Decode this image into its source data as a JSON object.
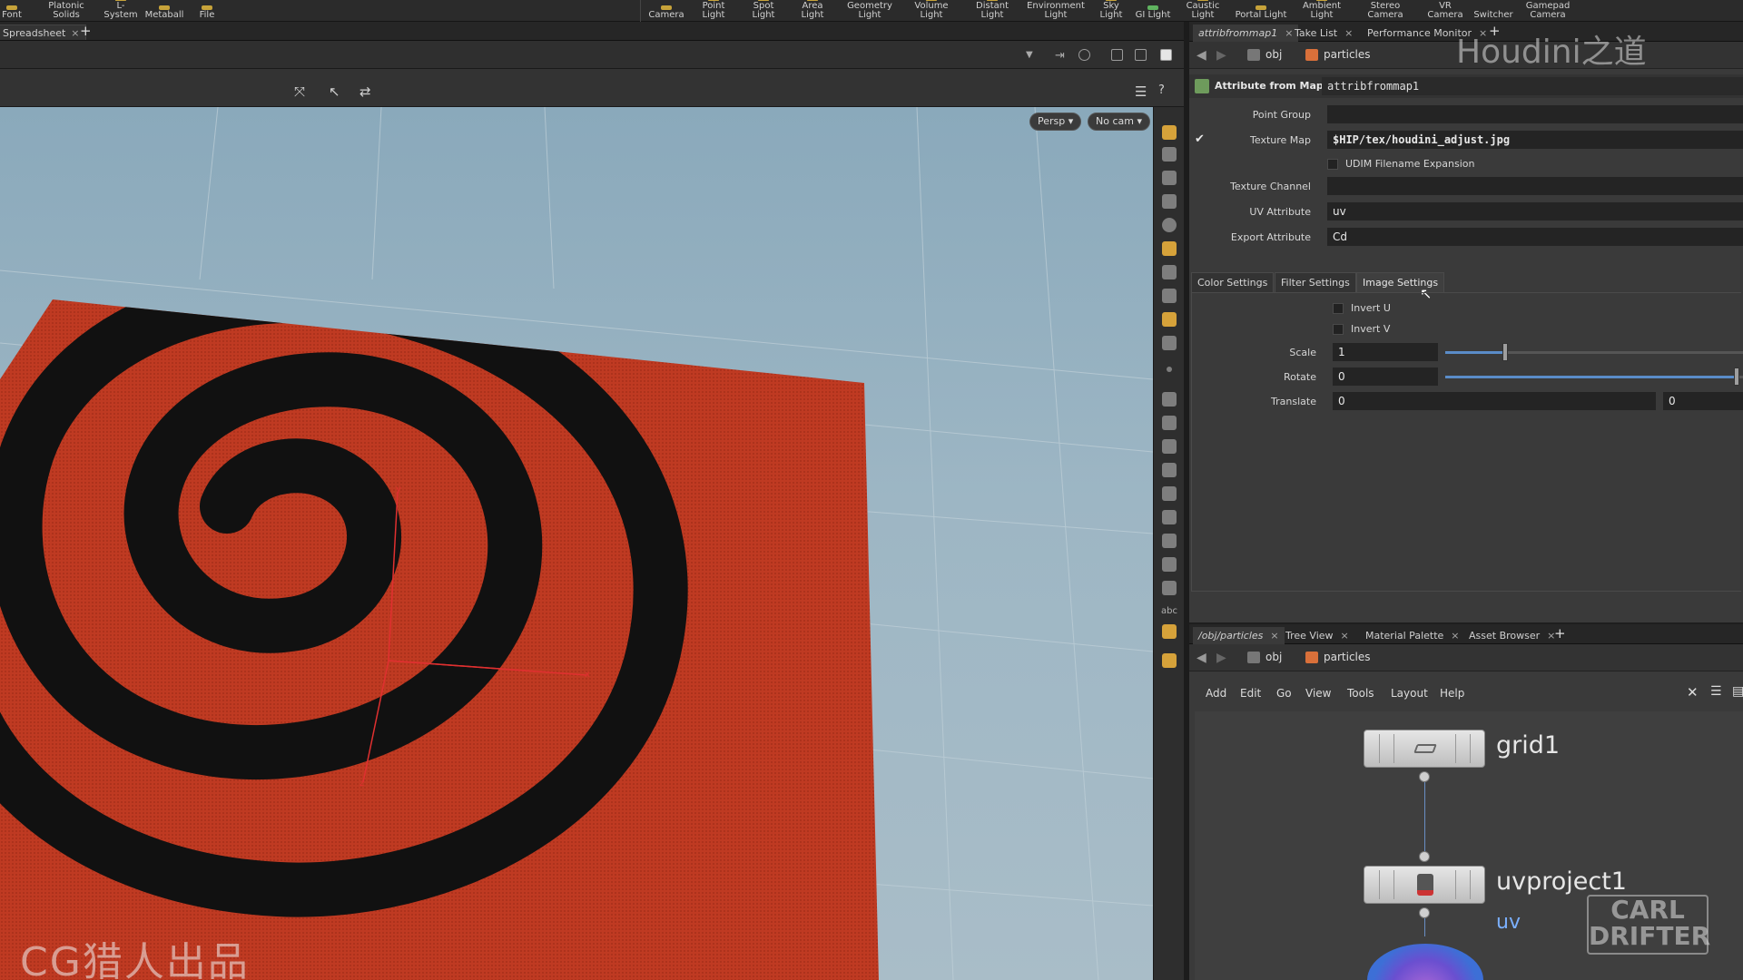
{
  "shelf": {
    "left_tools": [
      "Font",
      "Platonic\nSolids",
      "L-System",
      "Metaball",
      "File"
    ],
    "light_tools": [
      "Camera",
      "Point Light",
      "Spot Light",
      "Area Light",
      "Geometry\nLight",
      "Volume Light",
      "Distant Light",
      "Environment\nLight",
      "Sky Light",
      "GI Light",
      "Caustic Light",
      "Portal Light",
      "Ambient Light",
      "Stereo\nCamera",
      "VR Camera",
      "Switcher",
      "Gamepad\nCamera"
    ]
  },
  "left_pane": {
    "tab_label": "Spreadsheet",
    "tab_close": "×",
    "add_tab": "+",
    "viewport": {
      "persp_button": "Persp ▾",
      "cam_button": "No cam ▾",
      "abc_label": "abc"
    }
  },
  "param_pane": {
    "tabs": [
      {
        "label": "attribfrommap1",
        "close": "×"
      },
      {
        "label": "Take List",
        "close": "×"
      },
      {
        "label": "Performance Monitor",
        "close": "×"
      }
    ],
    "add_tab": "+",
    "path": {
      "obj": "obj",
      "node": "particles"
    },
    "node_type": "Attribute from Map",
    "node_name": "attribfrommap1",
    "params": {
      "point_group_label": "Point Group",
      "point_group_value": "",
      "texture_map_label": "Texture Map",
      "texture_map_value": "$HIP/tex/houdini_adjust.jpg",
      "udim_label": "UDIM Filename Expansion",
      "texture_channel_label": "Texture Channel",
      "texture_channel_value": "",
      "uv_attribute_label": "UV Attribute",
      "uv_attribute_value": "uv",
      "export_attribute_label": "Export Attribute",
      "export_attribute_value": "Cd"
    },
    "folder_tabs": [
      "Color Settings",
      "Filter Settings",
      "Image Settings"
    ],
    "active_folder": "Image Settings",
    "image_settings": {
      "invert_u_label": "Invert U",
      "invert_v_label": "Invert V",
      "scale_label": "Scale",
      "scale_value": "1",
      "scale_slider_fraction": 0.2,
      "rotate_label": "Rotate",
      "rotate_value": "0",
      "rotate_slider_fraction": 0.98,
      "translate_label": "Translate",
      "translate_x": "0",
      "translate_y": "0"
    }
  },
  "network_pane": {
    "tabs": [
      {
        "label": "/obj/particles",
        "close": "×"
      },
      {
        "label": "Tree View",
        "close": "×"
      },
      {
        "label": "Material Palette",
        "close": "×"
      },
      {
        "label": "Asset Browser",
        "close": "×"
      }
    ],
    "add_tab": "+",
    "path": {
      "obj": "obj",
      "node": "particles"
    },
    "menu": [
      "Add",
      "Edit",
      "Go",
      "View",
      "Tools",
      "Layout",
      "Help"
    ],
    "nodes": [
      {
        "name": "grid1"
      },
      {
        "name": "uvproject1",
        "flag": "uv"
      }
    ]
  },
  "watermarks": {
    "houdini": "Houdini之道",
    "cg": "CG猎人出品",
    "carl_line1": "CARL",
    "carl_line2": "DRIFTER"
  },
  "colors": {
    "accent_orange": "#d6a23a",
    "plane_red": "#bf3a22",
    "spiral_black": "#111111",
    "axis_red": "#e03030",
    "wire_blue": "#6a8fc4"
  }
}
